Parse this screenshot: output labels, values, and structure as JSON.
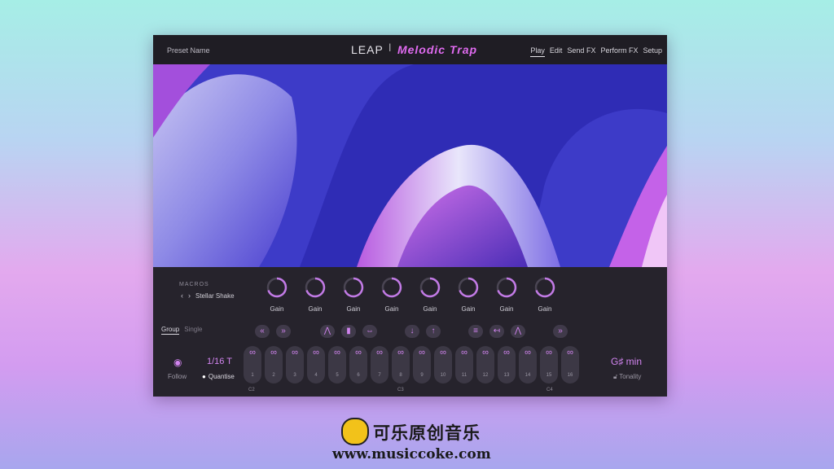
{
  "header": {
    "preset_name": "Preset Name",
    "logo_leap": "LEAP",
    "logo_sep": "|",
    "logo_brand": "Melodic Trap",
    "tabs": [
      "Play",
      "Edit",
      "Send FX",
      "Perform FX",
      "Setup"
    ],
    "active_tab": "Play"
  },
  "macros": {
    "title": "MACROS",
    "prev": "‹",
    "next": "›",
    "preset": "Stellar Shake",
    "knobs": [
      "Gain",
      "Gain",
      "Gain",
      "Gain",
      "Gain",
      "Gain",
      "Gain",
      "Gain"
    ]
  },
  "play": {
    "modes": [
      "Group",
      "Single"
    ],
    "follow_label": "Follow",
    "rate": "1/16 T",
    "quantise_label": "Quantise",
    "key": "G♯ min",
    "tonality_label": "Tonality",
    "pads": [
      "1",
      "2",
      "3",
      "4",
      "5",
      "6",
      "7",
      "8",
      "9",
      "10",
      "11",
      "12",
      "13",
      "14",
      "15",
      "16"
    ],
    "octaves": [
      "C2",
      "C3",
      "C4"
    ],
    "control_icons": [
      "rewind-icon",
      "forward-icon",
      "envelope-icon",
      "bars-icon",
      "swap-icon",
      "down-arrow-icon",
      "up-arrow-icon",
      "list-icon",
      "reverse-icon",
      "wave-icon",
      "forward-icon"
    ]
  },
  "watermark": {
    "title": "可乐原创音乐",
    "url": "www.musiccoke.com"
  },
  "colors": {
    "accent": "#d184ef",
    "panel": "#26232c",
    "topbar": "#1f1d24"
  }
}
